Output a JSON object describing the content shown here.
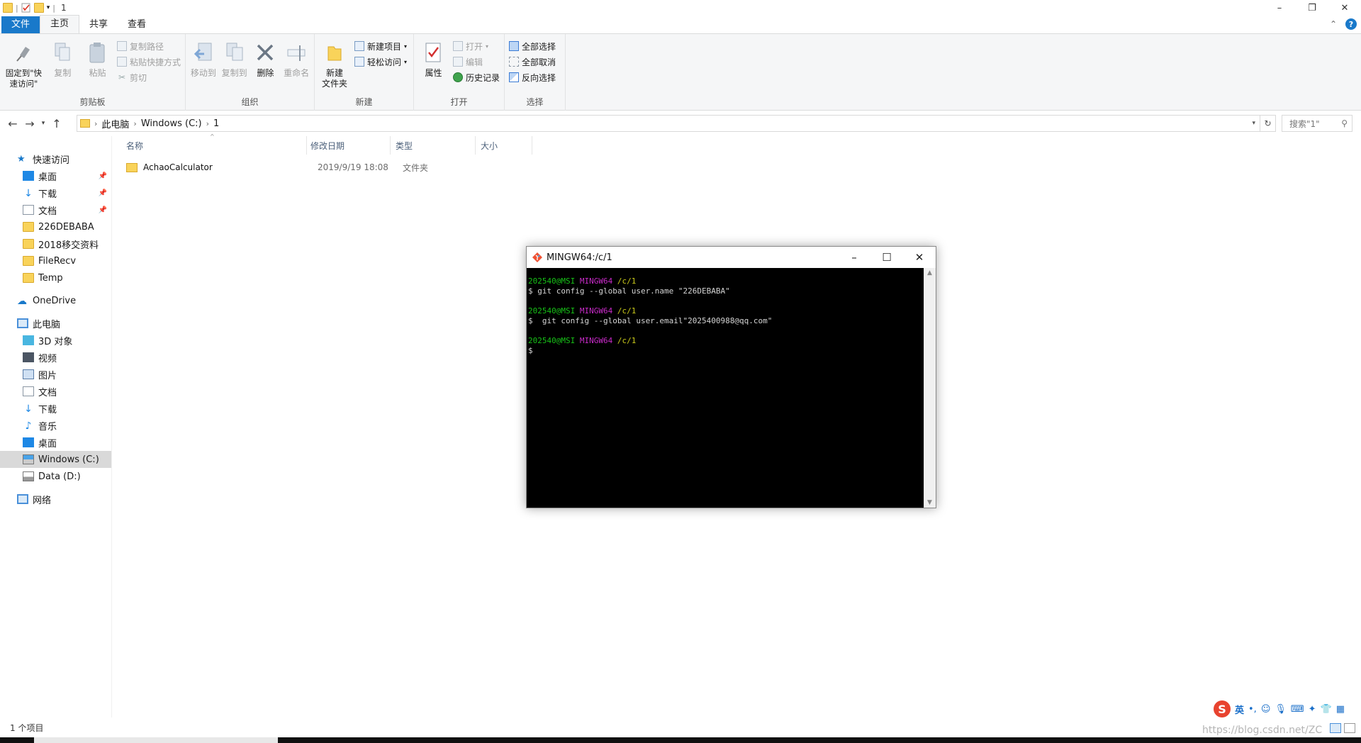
{
  "titlebar": {
    "title": "1",
    "sep": "|"
  },
  "tabs": {
    "file": "文件",
    "home": "主页",
    "share": "共享",
    "view": "查看",
    "help": "?"
  },
  "ribbon": {
    "clipboard": {
      "label": "剪贴板",
      "pin": "固定到\"快速访问\"",
      "copy": "复制",
      "paste": "粘贴",
      "copy_path": "复制路径",
      "paste_shortcut": "粘贴快捷方式",
      "cut": "剪切"
    },
    "organize": {
      "label": "组织",
      "move_to": "移动到",
      "copy_to": "复制到",
      "delete": "删除",
      "rename": "重命名"
    },
    "new": {
      "label": "新建",
      "new_folder": "新建\n文件夹",
      "new_item": "新建项目",
      "easy_access": "轻松访问"
    },
    "open": {
      "label": "打开",
      "properties": "属性",
      "open": "打开",
      "edit": "编辑",
      "history": "历史记录"
    },
    "select": {
      "label": "选择",
      "select_all": "全部选择",
      "select_none": "全部取消",
      "invert": "反向选择"
    }
  },
  "address": {
    "crumbs": [
      "此电脑",
      "Windows (C:)",
      "1"
    ],
    "search_placeholder": "搜索\"1\""
  },
  "nav": {
    "quick_access": "快速访问",
    "quick_items": [
      "桌面",
      "下载",
      "文档",
      "226DEBABA",
      "2018移交资料",
      "FileRecv",
      "Temp"
    ],
    "onedrive": "OneDrive",
    "this_pc": "此电脑",
    "pc_items": [
      "3D 对象",
      "视频",
      "图片",
      "文档",
      "下载",
      "音乐",
      "桌面",
      "Windows (C:)",
      "Data (D:)"
    ],
    "network": "网络"
  },
  "columns": {
    "name": "名称",
    "modified": "修改日期",
    "type": "类型",
    "size": "大小"
  },
  "files": [
    {
      "name": "AchaoCalculator",
      "modified": "2019/9/19 18:08",
      "type": "文件夹",
      "size": ""
    }
  ],
  "status": {
    "count": "1 个项目"
  },
  "terminal": {
    "title": "MINGW64:/c/1",
    "lines": [
      {
        "user": "202540@MSI",
        "env": "MINGW64",
        "path": "/c/1"
      },
      {
        "cmd": "$ git config --global user.name \"226DEBABA\""
      },
      {
        "user": "202540@MSI",
        "env": "MINGW64",
        "path": "/c/1"
      },
      {
        "cmd": "$  git config --global user.email\"2025400988@qq.com\""
      },
      {
        "user": "202540@MSI",
        "env": "MINGW64",
        "path": "/c/1"
      },
      {
        "cmd": "$"
      }
    ]
  },
  "ime": {
    "lang": "英",
    "punct": "•,"
  },
  "watermark": "https://blog.csdn.net/ZC"
}
